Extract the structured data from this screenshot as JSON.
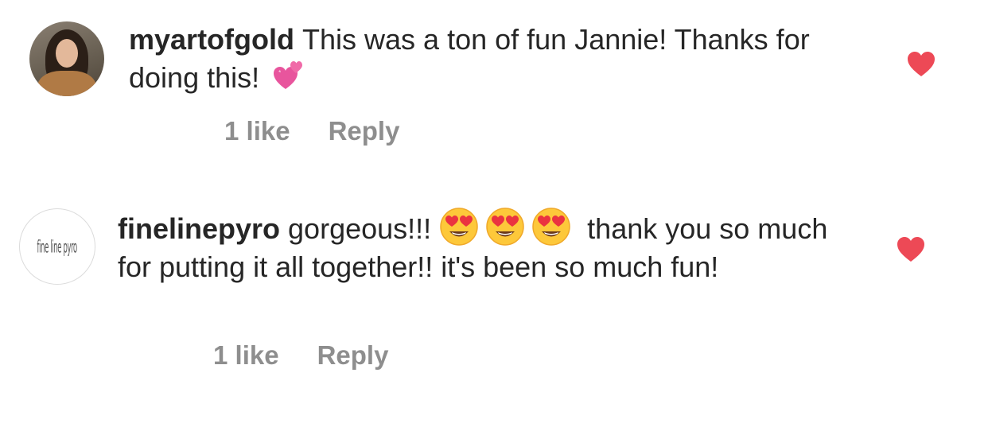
{
  "comments": [
    {
      "username": "myartofgold",
      "text": "This was a ton of fun Jannie! Thanks for doing this!",
      "emoji": "sparkling-heart",
      "likes_label": "1 like",
      "reply_label": "Reply",
      "liked": true
    },
    {
      "username": "finelinepyro",
      "text_before": "gorgeous!!!",
      "emojis": [
        "heart-eyes",
        "heart-eyes",
        "heart-eyes"
      ],
      "text_after": "thank you so much for putting it all together!! it's been so much fun!",
      "avatar_logo_text": "fine line pyro",
      "likes_label": "1 like",
      "reply_label": "Reply",
      "liked": true
    }
  ],
  "colors": {
    "like_heart": "#ed4956",
    "meta_text": "#8e8e8e",
    "body_text": "#262626"
  }
}
